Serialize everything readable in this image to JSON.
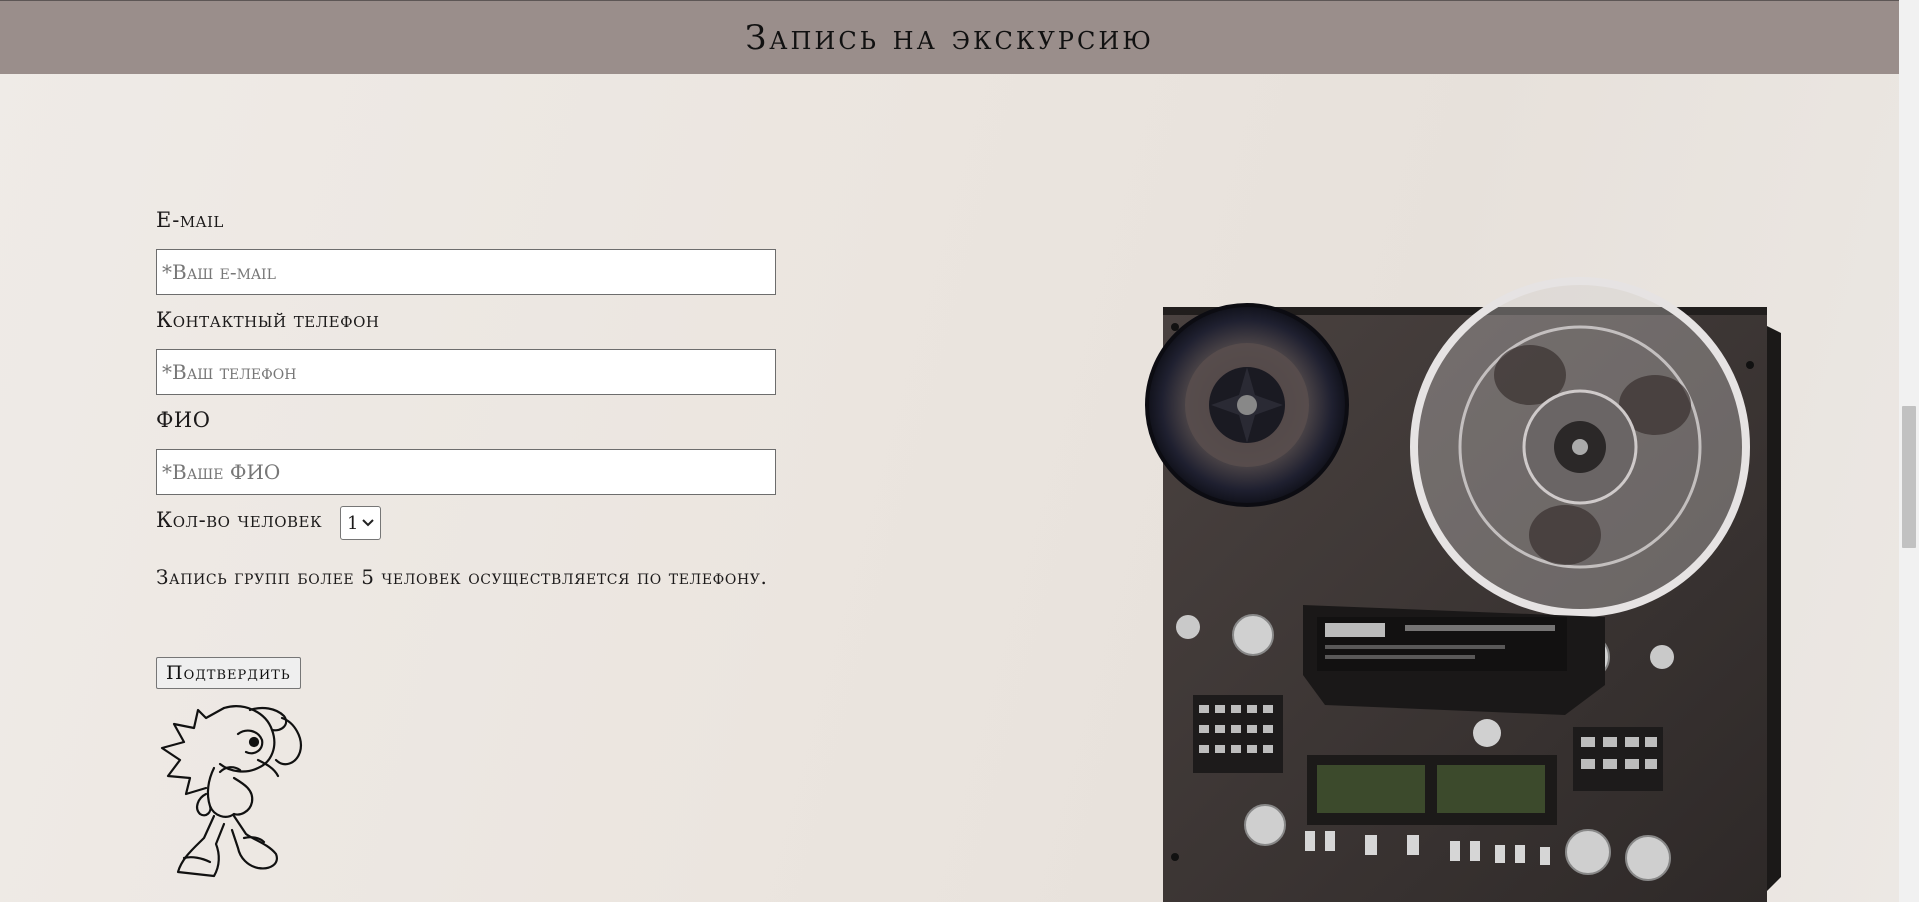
{
  "header": {
    "title": "Запись на экскурсию"
  },
  "form": {
    "email_label": "E-mail",
    "email_placeholder": "*Ваш e-mail",
    "phone_label": "Контактный телефон",
    "phone_placeholder": "*Ваш телефон",
    "name_label": "ФИО",
    "name_placeholder": "*Ваше ФИО",
    "people_label": "Кол-во человек",
    "people_value": "1",
    "note": "Запись групп более 5 человек осуществляется по телефону.",
    "submit_label": "Подтвердить"
  },
  "images": {
    "mascot_icon": "hedgehog-line-drawing-icon",
    "recorder_icon": "reel-to-reel-tape-recorder"
  },
  "colors": {
    "header_bg": "#9a8e8b",
    "page_bg": "#ebe5df"
  }
}
